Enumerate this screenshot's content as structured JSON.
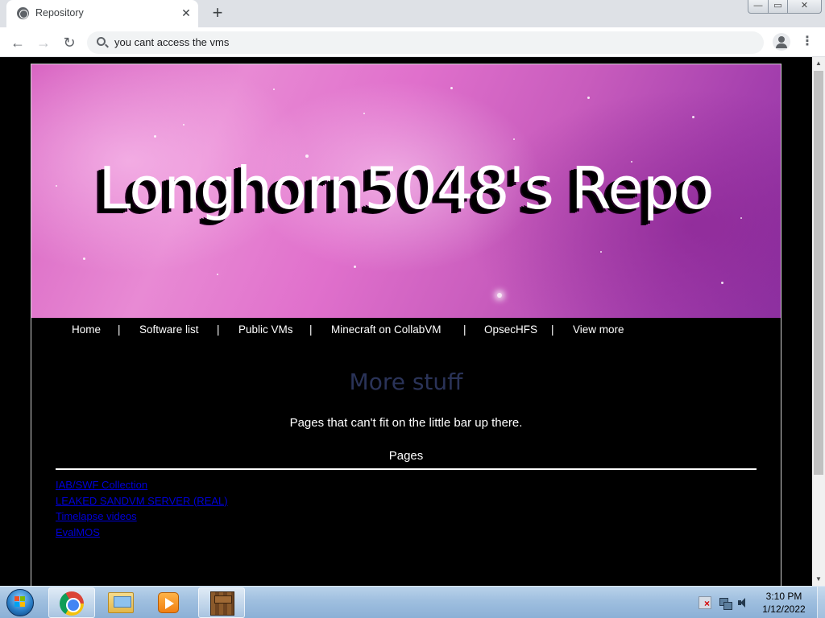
{
  "browser": {
    "tab_title": "Repository",
    "tab_close": "✕",
    "new_tab": "+",
    "address": "you cant access the vms",
    "window_controls": {
      "minimize": "—",
      "maximize": "▭",
      "close": "✕"
    },
    "nav": {
      "back": "←",
      "forward": "→",
      "reload": "↻"
    },
    "menu": "⋮"
  },
  "page": {
    "banner_title": "Longhorn5048's Repo",
    "nav_links": [
      "Home",
      "Software list",
      "Public VMs",
      "Minecraft on CollabVM",
      "OpsecHFS",
      "View more"
    ],
    "separator": "|",
    "heading": "More stuff",
    "description": "Pages that can't fit on the little bar up there.",
    "pages_label": "Pages",
    "page_links": [
      "IAB/SWF Collection",
      "LEAKED SANDVM SERVER (REAL)",
      "Timelapse videos",
      "EvalMOS"
    ],
    "heading_color": "#2a3358",
    "link_color": "#0000d8"
  },
  "taskbar": {
    "pinned": [
      "chrome-icon",
      "explorer-icon",
      "media-player-icon",
      "minecraft-icon"
    ],
    "time": "3:10 PM",
    "date": "1/12/2022"
  }
}
